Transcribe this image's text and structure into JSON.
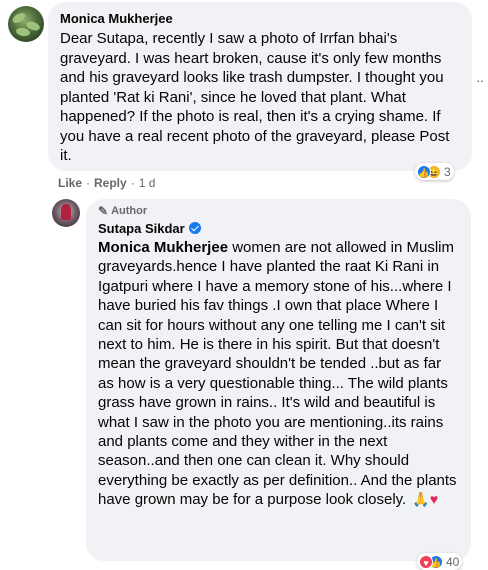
{
  "comment": {
    "author": "Monica Mukherjee",
    "text": "Dear Sutapa, recently I saw a photo of Irrfan bhai's graveyard. I was heart broken, cause it's only few months and his graveyard looks like trash dumpster. I thought you planted 'Rat ki Rani', since he loved that plant. What happened? If the photo is real, then it's a crying shame. If you have a real recent photo of the graveyard, please Post it.",
    "reaction_count": "3",
    "actions": {
      "like": "Like",
      "dot": "·",
      "reply": "Reply",
      "time": "1 d"
    },
    "more": "··"
  },
  "reply": {
    "badge": "Author",
    "author": "Sutapa Sikdar",
    "mention": "Monica Mukherjee",
    "text": " women are not allowed in Muslim graveyards.hence I have planted the raat Ki Rani in Igatpuri where I have a memory stone of his...where I have buried his fav things .I own that place Where I can sit for hours without any one telling me I can't sit next to him. He is there in his spirit. But that doesn't mean the graveyard shouldn't be tended ..but as far as how is a very questionable thing... The wild plants grass have grown in rains.. It's wild and beautiful is what I saw in the photo you are mentioning..its rains and plants come and they wither in the next season..and then one can clean it. Why should everything be exactly as per definition.. And the plants have grown may be for a purpose look closely.",
    "emoji_pray": "🙏",
    "emoji_heart": "♥",
    "reaction_count": "40"
  },
  "colors": {
    "bubble": "#f0f2f5",
    "meta": "#65676b",
    "like": "#1877f2",
    "heart": "#f33e58",
    "haha": "#f7b125"
  },
  "icons": {
    "author_badge": "pen-icon",
    "verified": "verified-badge-icon"
  }
}
